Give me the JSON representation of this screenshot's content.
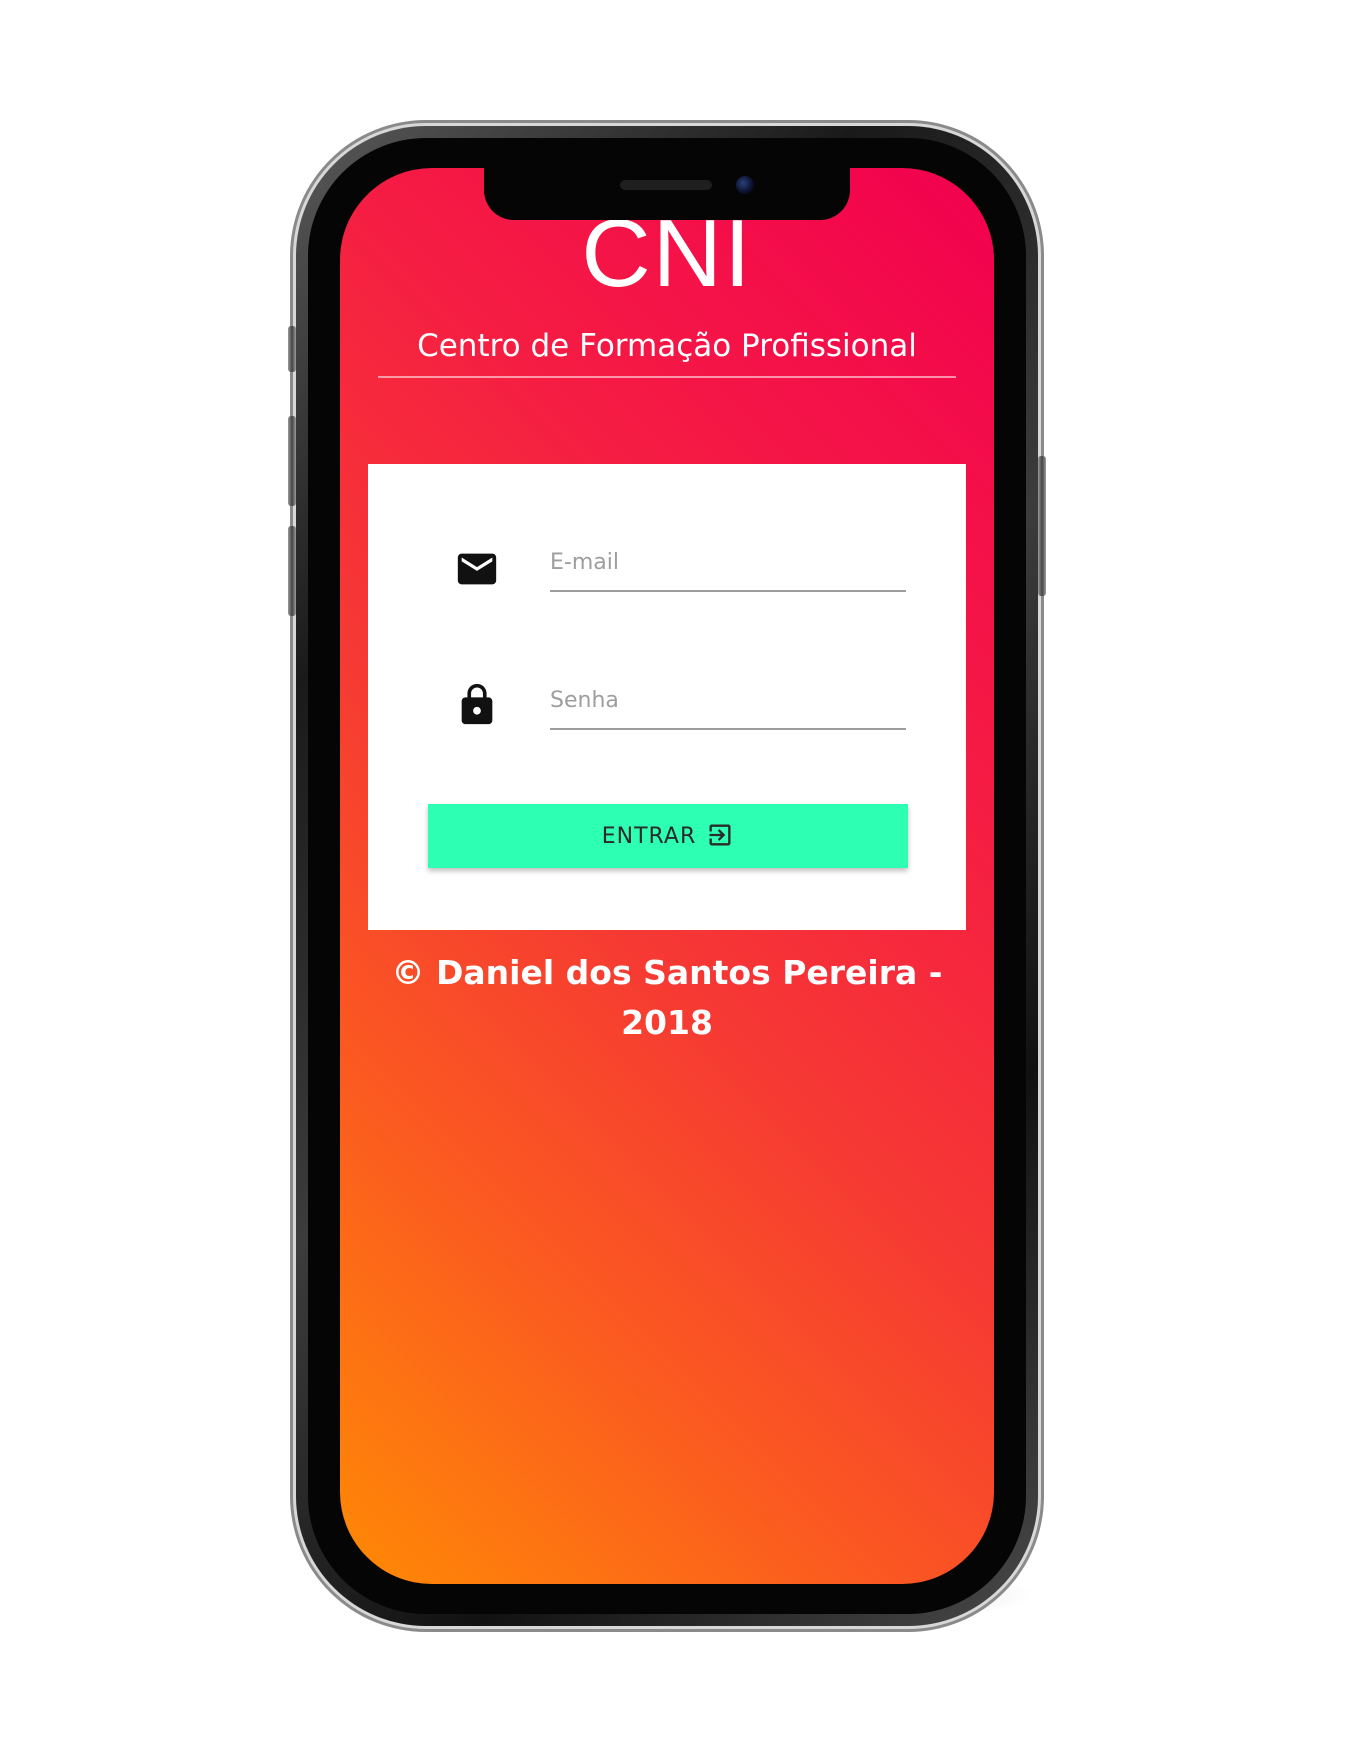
{
  "app": {
    "logo_text": "CNI",
    "subtitle": "Centro de Formação Profissional"
  },
  "login_form": {
    "email": {
      "icon": "email-envelope-icon",
      "placeholder": "E-mail",
      "value": ""
    },
    "password": {
      "icon": "lock-icon",
      "placeholder": "Senha",
      "value": ""
    },
    "submit": {
      "label": "ENTRAR",
      "icon": "login-exit-icon"
    }
  },
  "footer": {
    "copyright": "© Daniel dos Santos Pereira - 2018"
  },
  "colors": {
    "gradient_top": "#f2004f",
    "gradient_bottom": "#ff8a05",
    "button_accent": "#2dffb3",
    "card": "#ffffff"
  }
}
